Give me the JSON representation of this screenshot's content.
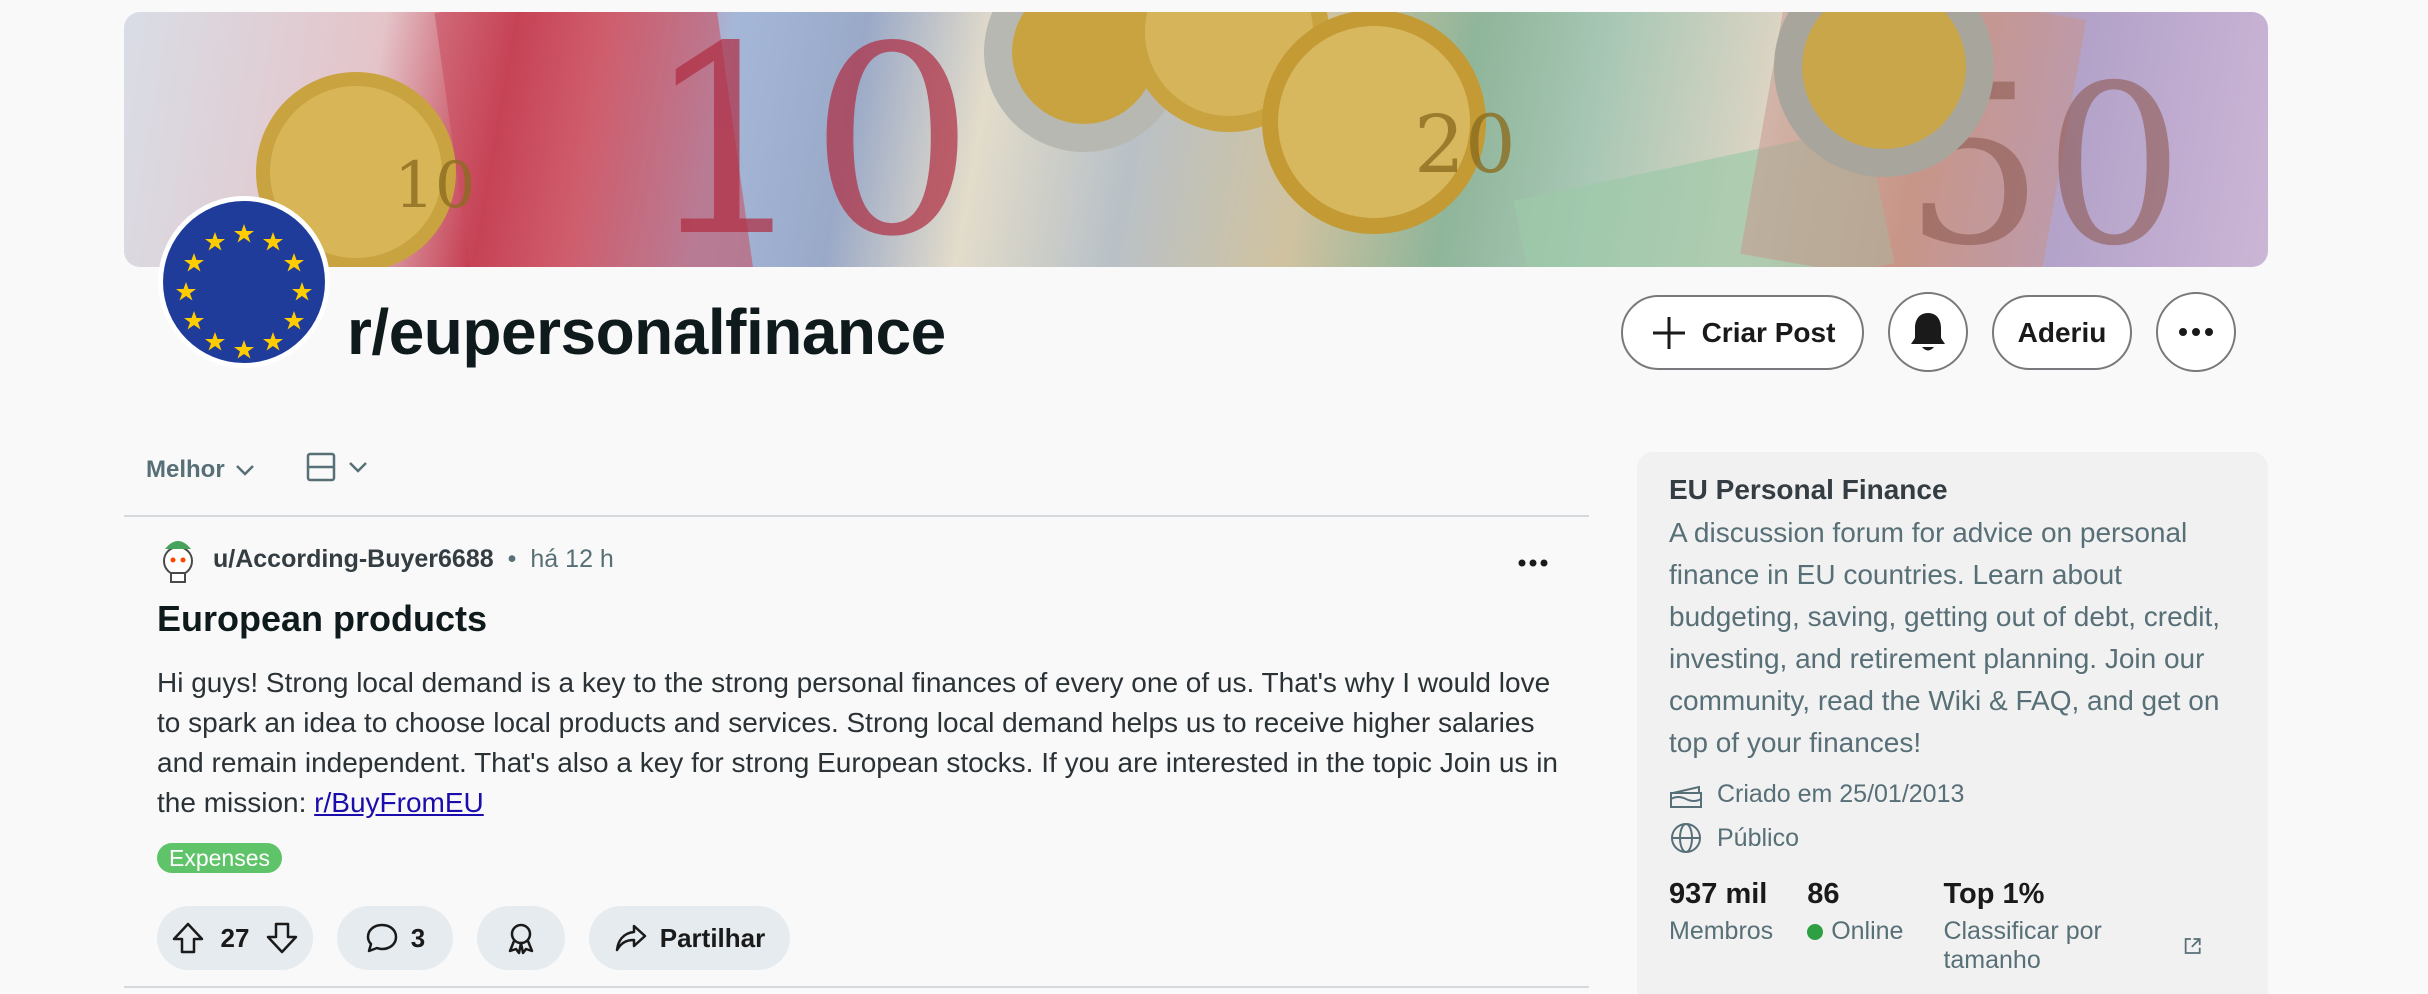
{
  "subreddit": {
    "name": "r/eupersonalfinance"
  },
  "header_buttons": {
    "create_post": "Criar Post",
    "join": "Aderiu"
  },
  "sort": {
    "label": "Melhor"
  },
  "post": {
    "author": "u/According-Buyer6688",
    "separator": "•",
    "time": "há 12 h",
    "title": "European products",
    "body": "Hi guys! Strong local demand is a key to the strong personal finances of every one of us. That's why I would love to spark an idea to choose local products and services. Strong local demand helps us to receive higher salaries and remain independent. That's also a key for strong European stocks. If you are interested in the topic Join us in the mission: ",
    "link_text": "r/BuyFromEU",
    "flair": "Expenses",
    "votes": "27",
    "comments": "3",
    "share_label": "Partilhar"
  },
  "sidebar": {
    "title": "EU Personal Finance",
    "description": "A discussion forum for advice on personal finance in EU countries. Learn about budgeting, saving, getting out of debt, credit, investing, and retirement planning. Join our community, read the Wiki & FAQ, and get on top of your finances!",
    "created": "Criado em 25/01/2013",
    "visibility": "Público",
    "stats": {
      "members_value": "937 mil",
      "members_label": "Membros",
      "online_value": "86",
      "online_label": "Online",
      "rank_value": "Top 1%",
      "rank_label": "Classificar por tamanho"
    }
  },
  "colors": {
    "flair": "#5fc469",
    "online_dot": "#2ea043",
    "eu_blue": "#1f3c9b",
    "eu_star": "#ffcc00"
  },
  "icons": [
    "plus-icon",
    "bell-icon",
    "more-icon",
    "chevron-down-icon",
    "layout-icon",
    "upvote-icon",
    "downvote-icon",
    "comment-icon",
    "award-icon",
    "share-icon",
    "cake-icon",
    "globe-icon",
    "external-link-icon"
  ]
}
